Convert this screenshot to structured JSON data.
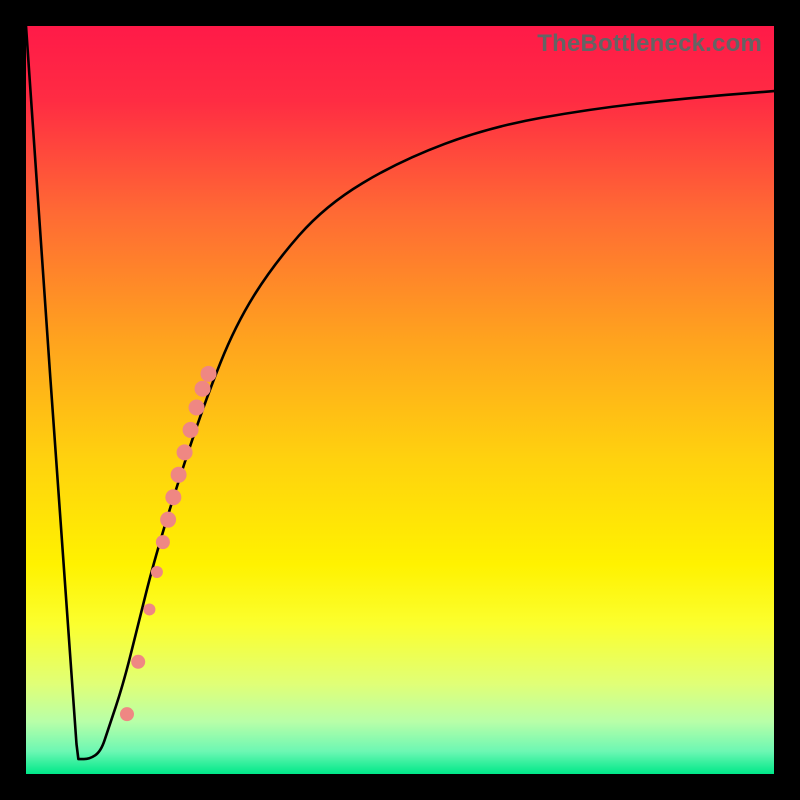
{
  "watermark": "TheBottleneck.com",
  "gradient_stops": [
    {
      "offset": 0.0,
      "color": "#ff1a48"
    },
    {
      "offset": 0.1,
      "color": "#ff2c43"
    },
    {
      "offset": 0.25,
      "color": "#ff6a34"
    },
    {
      "offset": 0.42,
      "color": "#ffa31e"
    },
    {
      "offset": 0.58,
      "color": "#ffd20e"
    },
    {
      "offset": 0.72,
      "color": "#fff200"
    },
    {
      "offset": 0.8,
      "color": "#fbff2e"
    },
    {
      "offset": 0.88,
      "color": "#e0ff77"
    },
    {
      "offset": 0.93,
      "color": "#b8ffa8"
    },
    {
      "offset": 0.97,
      "color": "#6cf7b3"
    },
    {
      "offset": 1.0,
      "color": "#00e889"
    }
  ],
  "chart_data": {
    "type": "line",
    "title": "",
    "xlabel": "",
    "ylabel": "",
    "xlim": [
      0,
      100
    ],
    "ylim": [
      0,
      100
    ],
    "series": [
      {
        "name": "bottleneck-curve",
        "x": [
          0,
          6.5,
          7,
          7,
          8.5,
          10,
          11,
          13,
          15,
          17,
          20,
          24,
          28,
          33,
          40,
          50,
          62,
          76,
          90,
          100
        ],
        "y": [
          100,
          6,
          2,
          2,
          2,
          3,
          6,
          12,
          20,
          28,
          38,
          50,
          60,
          68,
          76,
          82,
          86.5,
          89,
          90.5,
          91.3
        ]
      }
    ],
    "markers": [
      {
        "x": 13.5,
        "y": 8,
        "r": 7
      },
      {
        "x": 15.0,
        "y": 15,
        "r": 7
      },
      {
        "x": 16.5,
        "y": 22,
        "r": 6
      },
      {
        "x": 17.5,
        "y": 27,
        "r": 6
      },
      {
        "x": 18.3,
        "y": 31,
        "r": 7
      },
      {
        "x": 19.0,
        "y": 34,
        "r": 8
      },
      {
        "x": 19.7,
        "y": 37,
        "r": 8
      },
      {
        "x": 20.4,
        "y": 40,
        "r": 8
      },
      {
        "x": 21.2,
        "y": 43,
        "r": 8
      },
      {
        "x": 22.0,
        "y": 46,
        "r": 8
      },
      {
        "x": 22.8,
        "y": 49,
        "r": 8
      },
      {
        "x": 23.6,
        "y": 51.5,
        "r": 8
      },
      {
        "x": 24.4,
        "y": 53.5,
        "r": 8
      }
    ],
    "marker_color": "#ef8783"
  }
}
